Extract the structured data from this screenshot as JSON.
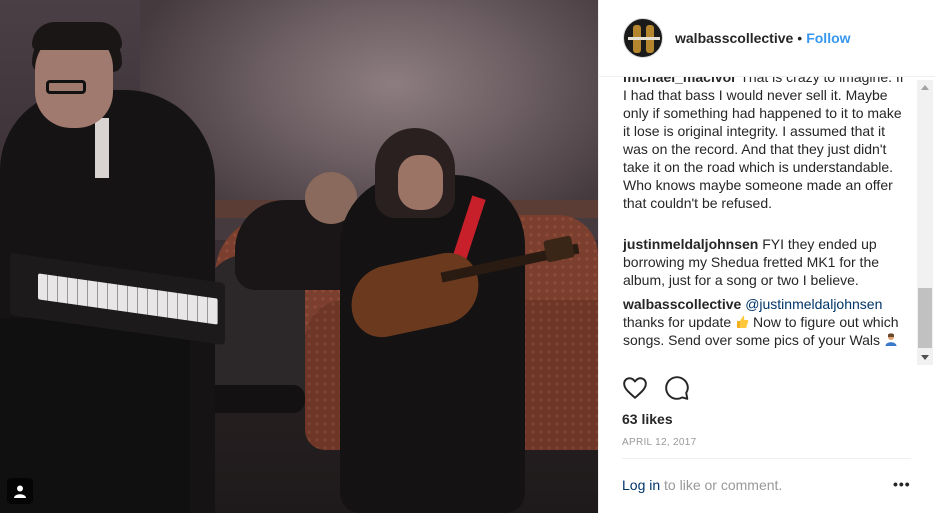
{
  "post": {
    "username": "walbasscollective",
    "separator": "•",
    "follow_label": "Follow"
  },
  "comments": [
    {
      "user": "michael_macivor",
      "text": "That is crazy to imagine. If I had that bass I would never sell it. Maybe only if something had happened to it to make it lose is original integrity. I assumed that it was on the record. And that they just didn't take it on the road which is understandable. Who knows maybe someone made an offer that couldn't be refused."
    },
    {
      "user": "justinmeldaljohnsen",
      "text": "FYI they ended up borrowing my Shedua fretted MK1 for the album, just for a song or two I believe."
    },
    {
      "user": "walbasscollective",
      "mention": "@justinmeldaljohnsen",
      "text_before_emoji": "thanks for update",
      "text_after_emoji": "Now to figure out which songs. Send over some pics of your Wals"
    }
  ],
  "likes": "63 likes",
  "date": "APRIL 12, 2017",
  "login": {
    "link": "Log in",
    "rest": "to like or comment."
  },
  "more_label": "•••",
  "icons": {
    "like": "heart-icon",
    "comment": "comment-bubble-icon",
    "media_type": "user-tag-icon",
    "avatar": "bass-guitar-avatar"
  },
  "colors": {
    "follow": "#3897f0",
    "text": "#262626",
    "muted": "#999999",
    "link": "#003569"
  }
}
